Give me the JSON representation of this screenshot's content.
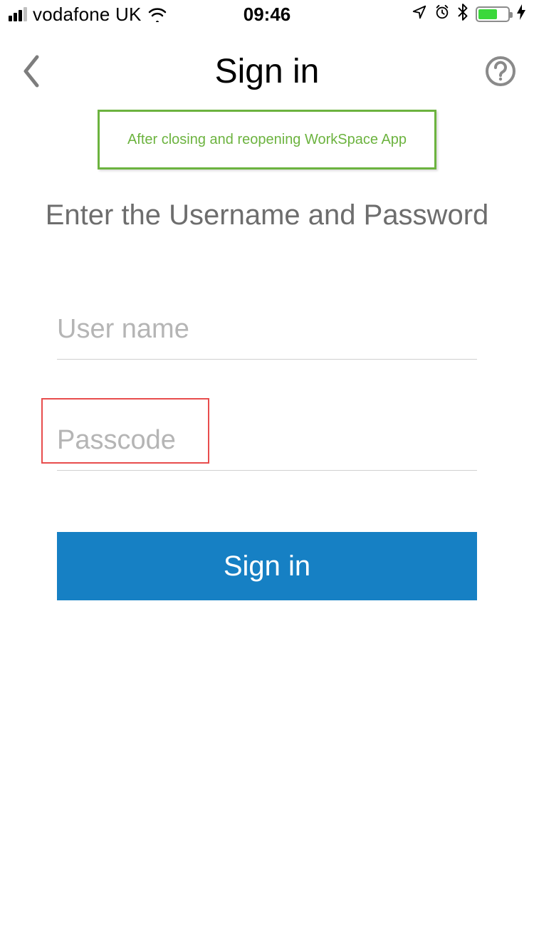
{
  "status_bar": {
    "carrier": "vodafone UK",
    "time": "09:46"
  },
  "nav": {
    "title": "Sign in"
  },
  "banner": {
    "text": "After closing and reopening WorkSpace App"
  },
  "heading": "Enter the Username and Password",
  "fields": {
    "username": {
      "placeholder": "User name",
      "value": ""
    },
    "passcode": {
      "placeholder": "Passcode",
      "value": ""
    }
  },
  "signin_button": "Sign in"
}
